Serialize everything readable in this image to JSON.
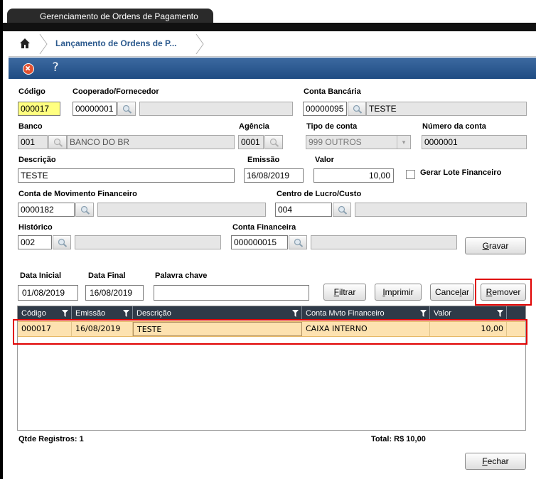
{
  "window": {
    "tab_title": "Gerenciamento de Ordens de Pagamento"
  },
  "breadcrumb": {
    "current": "Lançamento de Ordens de P..."
  },
  "toolbar": {
    "close": "close-icon",
    "help": "help-icon"
  },
  "form": {
    "codigo": {
      "label": "Código",
      "value": "000017"
    },
    "cooperado": {
      "label": "Cooperado/Fornecedor",
      "value": "00000001",
      "desc": ""
    },
    "conta_bancaria": {
      "label": "Conta Bancária",
      "value": "00000095",
      "desc": "TESTE"
    },
    "banco": {
      "label": "Banco",
      "value": "001",
      "desc": "BANCO DO BR"
    },
    "agencia": {
      "label": "Agência",
      "value": "0001"
    },
    "tipo_conta": {
      "label": "Tipo de conta",
      "value": "999 OUTROS"
    },
    "numero_conta": {
      "label": "Número da conta",
      "value": "0000001"
    },
    "descricao": {
      "label": "Descrição",
      "value": "TESTE"
    },
    "emissao": {
      "label": "Emissão",
      "value": "16/08/2019"
    },
    "valor": {
      "label": "Valor",
      "value": "10,00"
    },
    "gerar_lote": {
      "label": "Gerar Lote Financeiro",
      "checked": false
    },
    "conta_movimento": {
      "label": "Conta de Movimento Financeiro",
      "value": "0000182",
      "desc": ""
    },
    "centro_lucro": {
      "label": "Centro de Lucro/Custo",
      "value": "004",
      "desc": ""
    },
    "historico": {
      "label": "Histórico",
      "value": "002",
      "desc": ""
    },
    "conta_financeira": {
      "label": "Conta Financeira",
      "value": "000000015",
      "desc": ""
    },
    "gravar_prefix": "G",
    "gravar_rest": "ravar"
  },
  "filter": {
    "data_inicial": {
      "label": "Data Inicial",
      "value": "01/08/2019"
    },
    "data_final": {
      "label": "Data Final",
      "value": "16/08/2019"
    },
    "palavra_chave": {
      "label": "Palavra chave",
      "value": ""
    },
    "filtrar_prefix": "F",
    "filtrar_rest": "iltrar",
    "imprimir_prefix": "I",
    "imprimir_rest": "mprimir",
    "cancelar_main": "Cance",
    "cancelar_u": "l",
    "cancelar_rest": "ar",
    "remover_prefix": "R",
    "remover_rest": "emover"
  },
  "grid": {
    "columns": [
      "Código",
      "Emissão",
      "Descrição",
      "Conta Mvto Financeiro",
      "Valor"
    ],
    "rows": [
      {
        "codigo": "000017",
        "emissao": "16/08/2019",
        "descricao": "TESTE",
        "conta": "CAIXA INTERNO",
        "valor": "10,00"
      }
    ]
  },
  "footer": {
    "qtde": "Qtde Registros: 1",
    "total": "Total: R$ 10,00",
    "fechar_prefix": "F",
    "fechar_rest": "echar"
  },
  "colors": {
    "toolbar": "#1f4c83",
    "highlight": "#e00000",
    "row": "#fde2b0",
    "codigo_bg": "#ffff80"
  }
}
